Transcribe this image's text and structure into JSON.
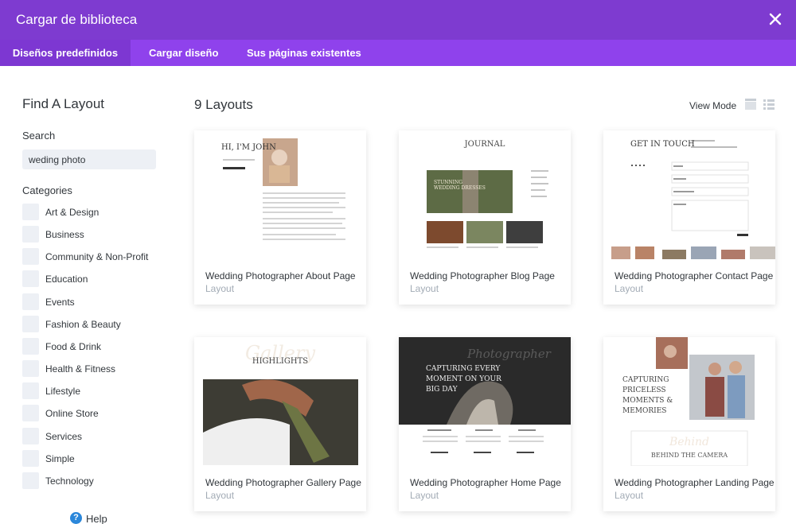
{
  "header": {
    "title": "Cargar de biblioteca"
  },
  "tabs": [
    {
      "label": "Diseños predefinidos"
    },
    {
      "label": "Cargar diseño"
    },
    {
      "label": "Sus páginas existentes"
    }
  ],
  "sidebar": {
    "heading": "Find A Layout",
    "search_label": "Search",
    "search_value": "weding photo",
    "categories_label": "Categories",
    "categories": [
      "Art & Design",
      "Business",
      "Community & Non-Profit",
      "Education",
      "Events",
      "Fashion & Beauty",
      "Food & Drink",
      "Health & Fitness",
      "Lifestyle",
      "Online Store",
      "Services",
      "Simple",
      "Technology"
    ],
    "help": "Help"
  },
  "main": {
    "count_title": "9 Layouts",
    "view_mode_label": "View Mode",
    "cards": [
      {
        "title": "Wedding Photographer About Page",
        "subtitle": "Layout"
      },
      {
        "title": "Wedding Photographer Blog Page",
        "subtitle": "Layout"
      },
      {
        "title": "Wedding Photographer Contact Page",
        "subtitle": "Layout"
      },
      {
        "title": "Wedding Photographer Gallery Page",
        "subtitle": "Layout"
      },
      {
        "title": "Wedding Photographer Home Page",
        "subtitle": "Layout"
      },
      {
        "title": "Wedding Photographer Landing Page",
        "subtitle": "Layout"
      }
    ],
    "previews": {
      "about_heading": "HI, I'M JOHN",
      "blog_heading": "JOURNAL",
      "blog_banner": "STUNNING WEDDING DRESSES",
      "contact_heading": "GET IN TOUCH",
      "gallery_script": "Gallery",
      "gallery_heading": "HIGHLIGHTS",
      "home_script": "Photographer",
      "home_heading": "CAPTURING EVERY MOMENT ON YOUR BIG DAY",
      "home_col1": "ENGAGEMENT",
      "home_col2": "WEDDING",
      "home_col3": "LIFESTYLE",
      "landing_heading": "CAPTURING PRICELESS MOMENTS & MEMORIES",
      "landing_script": "Behind",
      "landing_sub": "BEHIND THE CAMERA"
    }
  },
  "colors": {
    "header": "#7e3bd0",
    "tabs": "#8f42ec",
    "tab_active": "#7d37d2",
    "help_icon": "#2b87da"
  }
}
